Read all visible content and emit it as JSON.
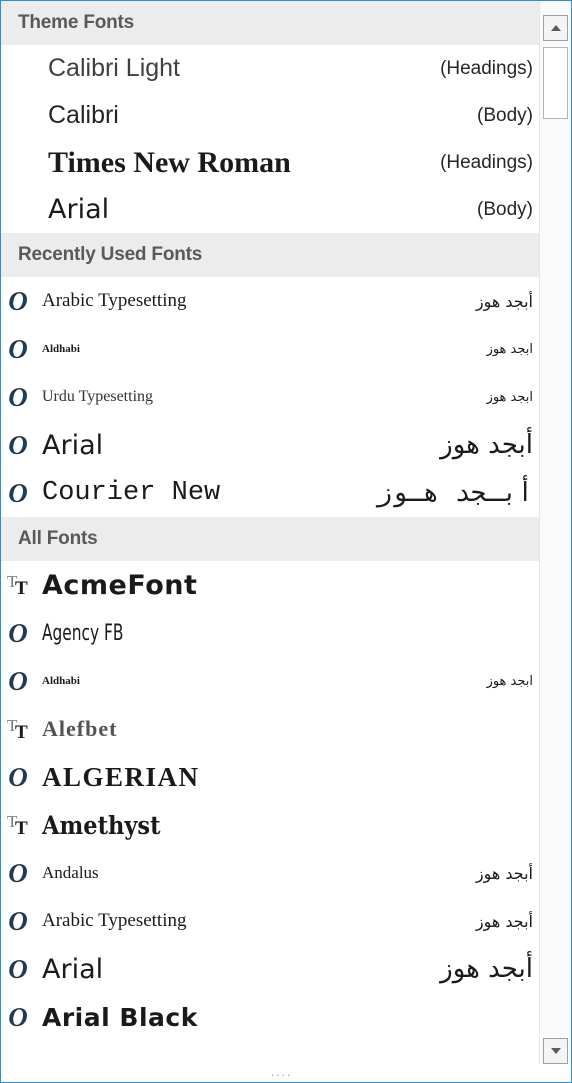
{
  "sections": {
    "theme_header": "Theme Fonts",
    "recent_header": "Recently Used Fonts",
    "all_header": "All Fonts"
  },
  "theme_fonts": [
    {
      "name": "Calibri Light",
      "role": "(Headings)"
    },
    {
      "name": "Calibri",
      "role": "(Body)"
    },
    {
      "name": "Times New Roman",
      "role": "(Headings)"
    },
    {
      "name": "Arial",
      "role": "(Body)"
    }
  ],
  "recent_fonts": [
    {
      "name": "Arabic Typesetting",
      "sample": "أبجد هوز",
      "icon": "opentype-icon"
    },
    {
      "name": "Aldhabi",
      "sample": "ابجد هوز",
      "icon": "opentype-icon"
    },
    {
      "name": "Urdu Typesetting",
      "sample": "ابجد هوز",
      "icon": "opentype-icon"
    },
    {
      "name": "Arial",
      "sample": "أبجد هوز",
      "icon": "opentype-icon"
    },
    {
      "name": "Courier New",
      "sample": "أبـجد هـوز",
      "icon": "opentype-icon"
    }
  ],
  "all_fonts": [
    {
      "name": "AcmeFont",
      "sample": "",
      "icon": "truetype-icon"
    },
    {
      "name": "Agency FB",
      "sample": "",
      "icon": "opentype-icon"
    },
    {
      "name": "Aldhabi",
      "sample": "ابجد هوز",
      "icon": "opentype-icon"
    },
    {
      "name": "Alefbet",
      "sample": "",
      "icon": "truetype-icon"
    },
    {
      "name": "ALGERIAN",
      "sample": "",
      "icon": "opentype-icon"
    },
    {
      "name": "Amethyst",
      "sample": "",
      "icon": "truetype-icon"
    },
    {
      "name": "Andalus",
      "sample": "أبجد هوز",
      "icon": "opentype-icon"
    },
    {
      "name": "Arabic Typesetting",
      "sample": "أبجد هوز",
      "icon": "opentype-icon"
    },
    {
      "name": "Arial",
      "sample": "أبجد هوز",
      "icon": "opentype-icon"
    },
    {
      "name": "Arial Black",
      "sample": "",
      "icon": "opentype-icon"
    }
  ],
  "icons": {
    "opentype_glyph": "O",
    "truetype_glyph_1": "T",
    "truetype_glyph_2": "T"
  },
  "grip": "....",
  "colors": {
    "accent_border": "#2b8fd6",
    "header_bg": "#ececec",
    "opentype_icon": "#1f3b57"
  }
}
